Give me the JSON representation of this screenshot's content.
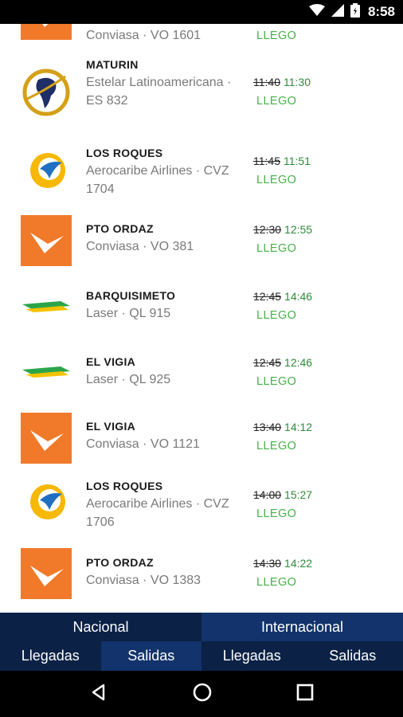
{
  "status_bar": {
    "time": "8:58"
  },
  "flights": [
    {
      "destination": "",
      "carrier": "Conviasa · VO 1601",
      "scheduled": "",
      "actual": "",
      "status": "LLEGO",
      "airline_logo": "conviasa-logo-icon"
    },
    {
      "destination": "MATURIN",
      "carrier": "Estelar Latinoamericana · ES 832",
      "scheduled": "11:40",
      "actual": "11:30",
      "status": "LLEGO",
      "airline_logo": "estelar-logo-icon"
    },
    {
      "destination": "LOS ROQUES",
      "carrier": "Aerocaribe Airlines · CVZ 1704",
      "scheduled": "11:45",
      "actual": "11:51",
      "status": "LLEGO",
      "airline_logo": "aerocaribe-logo-icon"
    },
    {
      "destination": "PTO ORDAZ",
      "carrier": "Conviasa · VO 381",
      "scheduled": "12:30",
      "actual": "12:55",
      "status": "LLEGO",
      "airline_logo": "conviasa-logo-icon"
    },
    {
      "destination": "BARQUISIMETO",
      "carrier": "Laser · QL 915",
      "scheduled": "12:45",
      "actual": "14:46",
      "status": "LLEGO",
      "airline_logo": "laser-logo-icon"
    },
    {
      "destination": "EL VIGIA",
      "carrier": "Laser · QL 925",
      "scheduled": "12:45",
      "actual": "12:46",
      "status": "LLEGO",
      "airline_logo": "laser-logo-icon"
    },
    {
      "destination": "EL VIGIA",
      "carrier": "Conviasa · VO 1121",
      "scheduled": "13:40",
      "actual": "14:12",
      "status": "LLEGO",
      "airline_logo": "conviasa-logo-icon"
    },
    {
      "destination": "LOS ROQUES",
      "carrier": "Aerocaribe Airlines · CVZ 1706",
      "scheduled": "14:00",
      "actual": "15:27",
      "status": "LLEGO",
      "airline_logo": "aerocaribe-logo-icon"
    },
    {
      "destination": "PTO ORDAZ",
      "carrier": "Conviasa · VO 1383",
      "scheduled": "14:30",
      "actual": "14:22",
      "status": "LLEGO",
      "airline_logo": "conviasa-logo-icon"
    }
  ],
  "tabs": {
    "nacional": "Nacional",
    "internacional": "Internacional",
    "nacional_llegadas": "Llegadas",
    "nacional_salidas": "Salidas",
    "internacional_llegadas": "Llegadas",
    "internacional_salidas": "Salidas"
  },
  "colors": {
    "tab_dark": "#0b2145",
    "tab_light": "#12336b",
    "status_green": "#47b04a",
    "actual_green": "#2e8b3a",
    "conviasa_orange": "#f07a2a"
  },
  "navbar": {
    "back": "back-icon",
    "home": "home-icon",
    "recents": "recents-icon"
  }
}
